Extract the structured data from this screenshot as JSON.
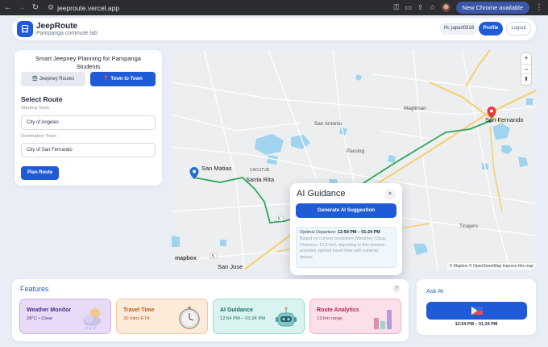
{
  "browser": {
    "url": "jeeproute.vercel.app",
    "update_label": "New Chrome available"
  },
  "header": {
    "title": "JeepRoute",
    "subtitle": "Pampanga commute lab",
    "greeting": "Hi, japuri0318",
    "profile_label": "Profile",
    "logout_label": "Logout"
  },
  "planner": {
    "title": "Smart Jeepney Planning for Pampanga Students",
    "tabs": [
      {
        "label": "🚍 Jeepney Routes",
        "active": false
      },
      {
        "label": "📍 Town to Town",
        "active": true
      }
    ],
    "section_title": "Select Route",
    "starting_label": "Starting Town",
    "starting_value": "City of Angeles",
    "destination_label": "Destination Town",
    "destination_value": "City of San Fernando",
    "plan_button": "Plan Route"
  },
  "map": {
    "zoom_in": "+",
    "zoom_out": "−",
    "compass": "⬆",
    "labels": {
      "san_matias": "San Matias",
      "santa_rita": "Santa Rita",
      "santa_rita_sub": "CACUTUD",
      "san_fernando": "San Fernando",
      "magliman": "Magliman",
      "san_antonio": "San Antonio",
      "parulog": "Parulog",
      "tinajero": "Tinajero",
      "san_jose": "San Jose",
      "road_5": "5"
    },
    "mapbox": "mapbox",
    "attribution": "© Mapbox © OpenStreetMap  Improve this map"
  },
  "ai_guidance": {
    "title": "AI Guidance",
    "close": "×",
    "button": "Generate AI Suggestion",
    "departure_label": "Optimal Departure:",
    "departure_time": "12:54 PM – 01:24 PM",
    "details": "Based on current conditions (Weather: Clear, Distance: 12.6 km), departing in this window provides optimal travel time with minimal delays."
  },
  "features": {
    "title": "Features",
    "help": "?",
    "cards": [
      {
        "title": "Weather Monitor",
        "subtitle": "28°C • Clear",
        "icon": "weather-icon",
        "color": "#e8dbf7"
      },
      {
        "title": "Travel Time",
        "subtitle": "30 mins ETA",
        "icon": "clock-icon",
        "color": "#fdebd9"
      },
      {
        "title": "AI Guidance",
        "subtitle": "12:54 PM – 01:24 PM",
        "icon": "robot-icon",
        "color": "#d8f3f0"
      },
      {
        "title": "Route Analytics",
        "subtitle": "13 km range",
        "icon": "bar-chart-icon",
        "color": "#fbe0ea"
      }
    ]
  },
  "ask_ai": {
    "title": "Ask AI",
    "time": "12:54 PM – 01:24 PM"
  }
}
